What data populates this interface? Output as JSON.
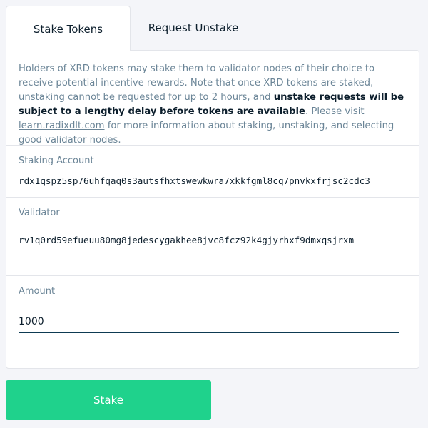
{
  "tabs": {
    "stake": "Stake Tokens",
    "unstake": "Request Unstake"
  },
  "info": {
    "part1": "Holders of XRD tokens may stake them to validator nodes of their choice to receive potential incentive rewards. Note that once XRD tokens are staked, unstaking cannot be requested for up to 2 hours, and ",
    "bold": "unstake requests will be subject to a lengthy delay before tokens are available",
    "part2": ". Please visit ",
    "link": "learn.radixdlt.com",
    "part3": " for more information about staking, unstaking, and selecting good validator nodes."
  },
  "staking_account": {
    "label": "Staking Account",
    "value": "rdx1qspz5sp76uhfqaq0s3autsfhxtswewkwra7xkkfgml8cq7pnvkxfrjsc2cdc3"
  },
  "validator": {
    "label": "Validator",
    "value": "rv1q0rd59efueuu80mg8jedescygakhee8jvc8fcz92k4gjyrhxf9dmxqsjrxm"
  },
  "amount": {
    "label": "Amount",
    "value": "1000"
  },
  "stake_button": "Stake",
  "colors": {
    "accent": "#1fd28c",
    "focus": "#28c9a4",
    "muted": "#6b8597"
  }
}
